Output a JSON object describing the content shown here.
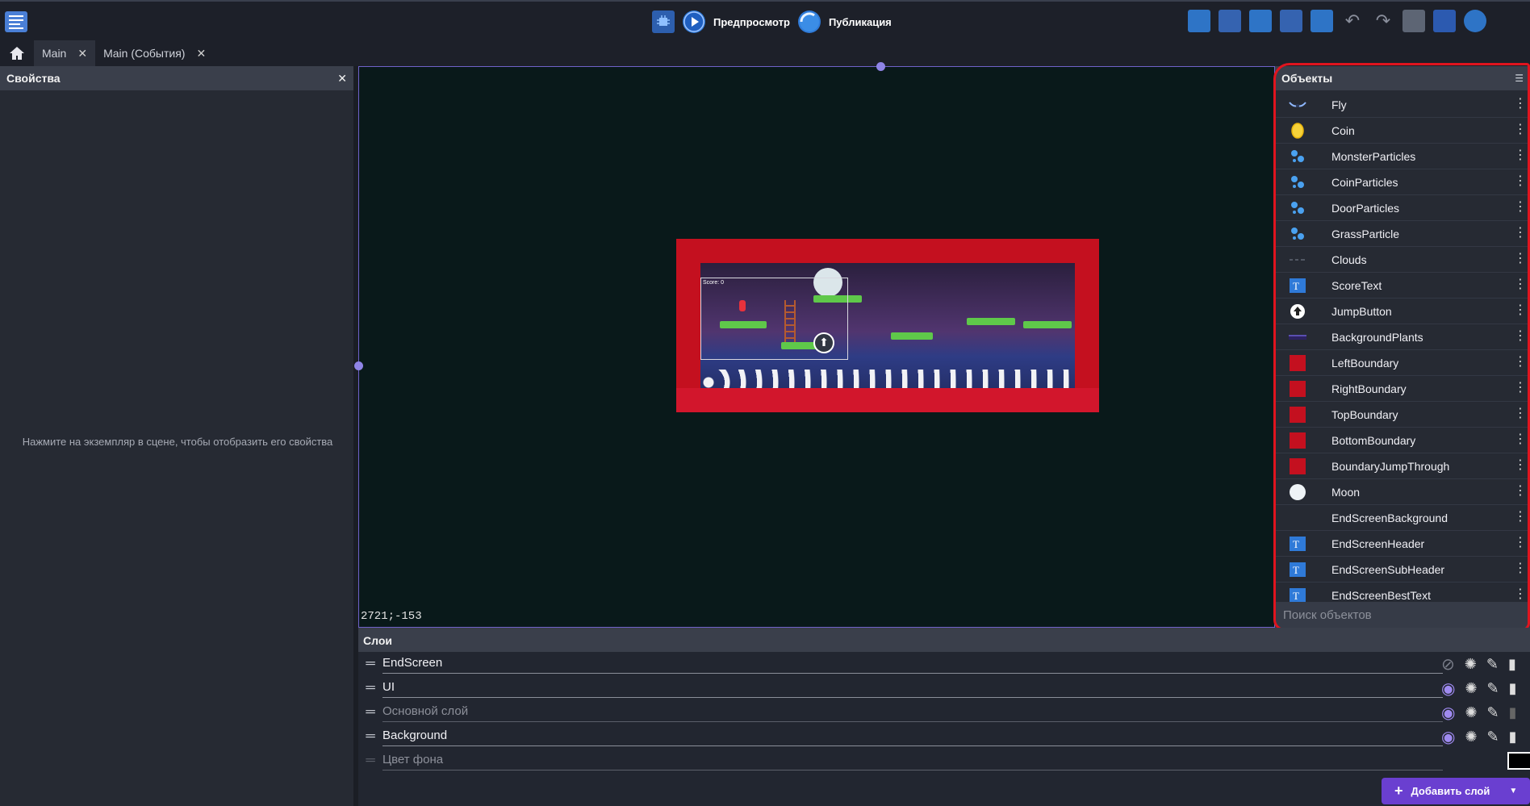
{
  "toolbar": {
    "preview_label": "Предпросмотр",
    "publish_label": "Публикация"
  },
  "tabs": [
    {
      "label": "Main",
      "active": true
    },
    {
      "label": "Main (События)",
      "active": false
    }
  ],
  "properties_panel": {
    "title": "Свойства",
    "hint": "Нажмите на экземпляр в сцене, чтобы отобразить его свойства"
  },
  "scene": {
    "coordinates": "2721;-153",
    "game_score_text": "Score: 0"
  },
  "objects_panel": {
    "title": "Объекты",
    "search_placeholder": "Поиск объектов",
    "items": [
      {
        "label": "Fly",
        "icon": "fly-icon"
      },
      {
        "label": "Coin",
        "icon": "coin-icon"
      },
      {
        "label": "MonsterParticles",
        "icon": "particles-icon"
      },
      {
        "label": "CoinParticles",
        "icon": "particles-icon"
      },
      {
        "label": "DoorParticles",
        "icon": "particles-icon"
      },
      {
        "label": "GrassParticle",
        "icon": "particles-icon"
      },
      {
        "label": "Clouds",
        "icon": "clouds-icon"
      },
      {
        "label": "ScoreText",
        "icon": "text-icon"
      },
      {
        "label": "JumpButton",
        "icon": "jump-icon"
      },
      {
        "label": "BackgroundPlants",
        "icon": "plants-icon"
      },
      {
        "label": "LeftBoundary",
        "icon": "red-square-icon"
      },
      {
        "label": "RightBoundary",
        "icon": "red-square-icon"
      },
      {
        "label": "TopBoundary",
        "icon": "red-square-icon"
      },
      {
        "label": "BottomBoundary",
        "icon": "red-square-icon"
      },
      {
        "label": "BoundaryJumpThrough",
        "icon": "red-square-icon"
      },
      {
        "label": "Moon",
        "icon": "moon-icon"
      },
      {
        "label": "EndScreenBackground",
        "icon": "blank-icon"
      },
      {
        "label": "EndScreenHeader",
        "icon": "text-icon"
      },
      {
        "label": "EndScreenSubHeader",
        "icon": "text-icon"
      },
      {
        "label": "EndScreenBestText",
        "icon": "text-icon"
      }
    ]
  },
  "layers_panel": {
    "title": "Слои",
    "layers": [
      {
        "name": "EndScreen",
        "visible": false,
        "muted": false
      },
      {
        "name": "UI",
        "visible": true,
        "muted": false
      },
      {
        "name": "Основной слой",
        "visible": true,
        "muted": true
      },
      {
        "name": "Background",
        "visible": true,
        "muted": false
      }
    ],
    "background_color_label": "Цвет фона",
    "add_layer_label": "Добавить слой"
  },
  "colors": {
    "accent": "#6a3fd0",
    "highlight": "#e0141e"
  }
}
